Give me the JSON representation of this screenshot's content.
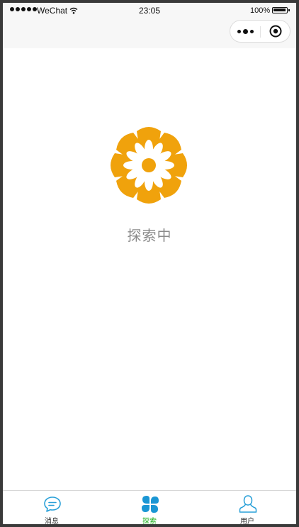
{
  "status_bar": {
    "carrier": "WeChat",
    "time": "23:05",
    "battery": "100%"
  },
  "main": {
    "status_text": "探索中",
    "logo_icon": "flower-icon",
    "logo_color": "#f0a20c"
  },
  "tab_bar": {
    "active_color": "#1aad19",
    "tabs": [
      {
        "label": "消息",
        "icon": "chat-bubble-icon",
        "active": false
      },
      {
        "label": "探索",
        "icon": "clover-icon",
        "active": true
      },
      {
        "label": "用户",
        "icon": "user-icon",
        "active": false
      }
    ]
  }
}
